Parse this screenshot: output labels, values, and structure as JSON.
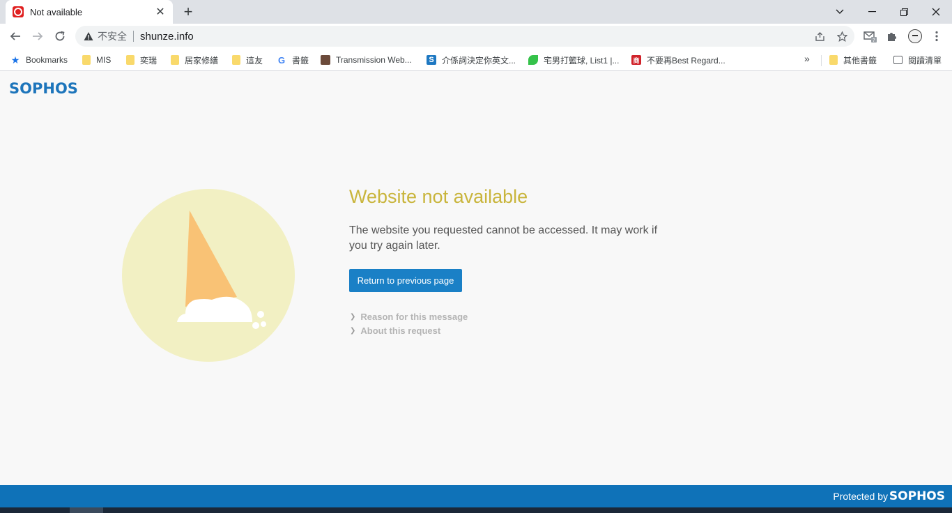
{
  "browser": {
    "tab": {
      "title": "Not available"
    },
    "address": {
      "security_label": "不安全",
      "url": "shunze.info"
    }
  },
  "bookmarks": [
    {
      "label": "Bookmarks",
      "icon": "star-icon"
    },
    {
      "label": "MIS",
      "icon": "folder-icon"
    },
    {
      "label": "奕瑞",
      "icon": "folder-icon"
    },
    {
      "label": "居家修繕",
      "icon": "folder-icon"
    },
    {
      "label": "這友",
      "icon": "folder-icon"
    },
    {
      "label": "書籤",
      "icon": "google-icon"
    },
    {
      "label": "Transmission Web...",
      "icon": "transmission-icon"
    },
    {
      "label": "介係詞決定你英文...",
      "icon": "s-icon"
    },
    {
      "label": "宅男打籃球, List1 |...",
      "icon": "leaf-icon"
    },
    {
      "label": "不要再Best Regard...",
      "icon": "red-square-icon"
    }
  ],
  "bookmarks_right": [
    {
      "label": "其他書籤",
      "icon": "folder-icon"
    },
    {
      "label": "閱讀清單",
      "icon": "reading-list-icon"
    }
  ],
  "page": {
    "logo": "SOPHOS",
    "heading": "Website not available",
    "message": "The website you requested cannot be accessed. It may work if you try again later.",
    "return_button": "Return to previous page",
    "links": [
      "Reason for this message",
      "About this request"
    ]
  },
  "footer": {
    "protected_by": "Protected by",
    "logo": "SOPHOS"
  },
  "colors": {
    "brand_blue": "#1d75bb",
    "heading_gold": "#c9b53c",
    "circle_bg": "#f2f0c3",
    "cone_orange": "#f9c275",
    "footer_blue": "#0f72b8"
  }
}
